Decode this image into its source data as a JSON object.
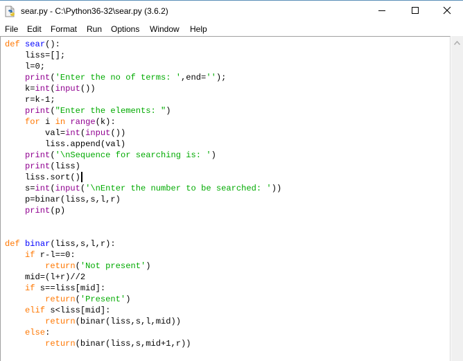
{
  "window": {
    "title": "sear.py - C:\\Python36-32\\sear.py (3.6.2)",
    "icon": "python-file-icon",
    "controls": {
      "minimize": "minimize-icon",
      "maximize": "maximize-icon",
      "close": "close-icon"
    }
  },
  "menubar": {
    "items": [
      "File",
      "Edit",
      "Format",
      "Run",
      "Options",
      "Window",
      "Help"
    ]
  },
  "editor": {
    "language": "python",
    "colors": {
      "keyword": "#ff7700",
      "definition": "#0000ff",
      "builtin": "#900090",
      "string": "#00aa00",
      "text": "#000000"
    },
    "cursor_line": 13,
    "lines": [
      "def sear():",
      "    liss=[];",
      "    l=0;",
      "    print('Enter the no of terms: ',end='');",
      "    k=int(input())",
      "    r=k-1;",
      "    print(\"Enter the elements: \")",
      "    for i in range(k):",
      "        val=int(input())",
      "        liss.append(val)",
      "    print('\\nSequence for searching is: ')",
      "    print(liss)",
      "    liss.sort()",
      "    s=int(input('\\nEnter the number to be searched: '))",
      "    p=binar(liss,s,l,r)",
      "    print(p)",
      "",
      "",
      "def binar(liss,s,l,r):",
      "    if r-l==0:",
      "        return('Not present')",
      "    mid=(l+r)//2",
      "    if s==liss[mid]:",
      "        return('Present')",
      "    elif s<liss[mid]:",
      "        return(binar(liss,s,l,mid))",
      "    else:",
      "        return(binar(liss,s,mid+1,r))"
    ]
  },
  "scrollbar": {
    "up_arrow": "chevron-up-icon"
  }
}
